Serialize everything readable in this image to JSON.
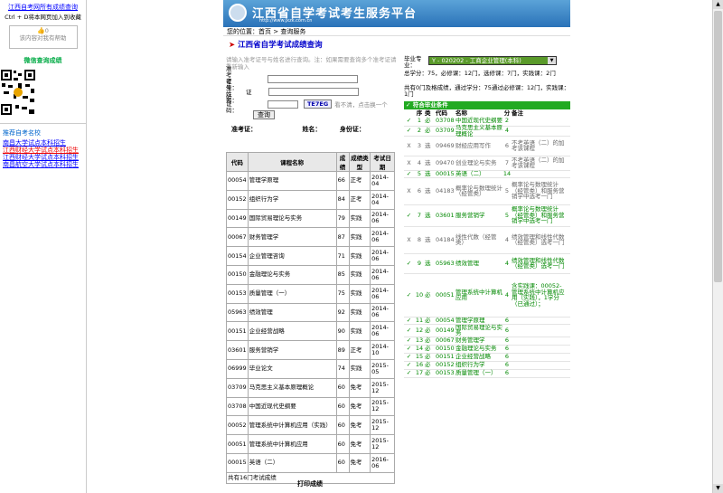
{
  "left": {
    "title": "江西自考网所有成绩查询",
    "hint": "Ctrl + D将本网页加入到收藏",
    "vote_count": "0",
    "vote_text": "该内容对我有帮助",
    "qr_title": "微信查询成绩",
    "recommend_title": "推荐自考名校",
    "links": [
      {
        "text": "南昌大学试点本科招生",
        "red": false
      },
      {
        "text": "江西财经大学试点本科招生",
        "red": true
      },
      {
        "text": "江西财经大学试点本科招生",
        "red": false
      },
      {
        "text": "南昌航空大学试点本科招生",
        "red": false
      }
    ]
  },
  "banner": {
    "title": "江西省自学考试考生服务平台",
    "url": "http://www.jxzk.com.cn"
  },
  "crumb": {
    "prefix": "您的位置：",
    "home": "首页",
    "sep": " > ",
    "page": "查询服务"
  },
  "page_title": "江西省自学考试成绩查询",
  "form": {
    "notice": "请输入准考证号与姓名进行查询。注：如果需要查询多个准考证请重新输入",
    "f1": "准考证号：",
    "f2": "考生姓名：",
    "f3": "验证码：",
    "mid_label": "证",
    "captcha": "TE7EG",
    "captcha_hint": "看不清，点击换一个",
    "submit": "查询"
  },
  "info": {
    "ticket_label": "准考证：",
    "name_label": "姓名：",
    "id_label": "身份证："
  },
  "grades": {
    "headers": [
      "代码",
      "课程名称",
      "成绩",
      "成绩类型",
      "考试日期"
    ],
    "rows": [
      [
        "00054",
        "管理学原理",
        "66",
        "正考",
        "2014-04"
      ],
      [
        "00152",
        "组织行为学",
        "84",
        "正考",
        "2014-04"
      ],
      [
        "00149",
        "国际贸易理论与实务",
        "79",
        "实践",
        "2014-06"
      ],
      [
        "00067",
        "财务管理学",
        "87",
        "实践",
        "2014-06"
      ],
      [
        "00154",
        "企业管理咨询",
        "71",
        "实践",
        "2014-06"
      ],
      [
        "00150",
        "金融理论与实务",
        "85",
        "实践",
        "2014-06"
      ],
      [
        "00153",
        "质量管理（一）",
        "75",
        "实践",
        "2014-06"
      ],
      [
        "05963",
        "绩效管理",
        "92",
        "实践",
        "2014-06"
      ],
      [
        "00151",
        "企业经营战略",
        "90",
        "实践",
        "2014-06"
      ],
      [
        "03601",
        "服务营销学",
        "89",
        "正考",
        "2014-10"
      ],
      [
        "06999",
        "毕业论文",
        "74",
        "实践",
        "2015-05"
      ],
      [
        "03709",
        "马克思主义基本原理概论",
        "60",
        "免考",
        "2015-12"
      ],
      [
        "03708",
        "中国近现代史纲要",
        "60",
        "免考",
        "2015-12"
      ],
      [
        "00052",
        "管理系统中计算机应用（实践）",
        "60",
        "免考",
        "2015-12"
      ],
      [
        "00051",
        "管理系统中计算机应用",
        "60",
        "免考",
        "2015-12"
      ],
      [
        "00015",
        "英语（二）",
        "60",
        "免考",
        "2016-06"
      ]
    ],
    "footer": "共有16门考试成绩",
    "print": "打印成绩"
  },
  "plan": {
    "major_label": "毕业专业：",
    "major_value": "Y - 020202 - 工商企业管理(本科)",
    "summary": "总学分：75，必修课：12门，选修课：7门，实践课：2门",
    "status": "共有0门及格成绩，通过学分：75通过必修课：12门，实践课：1门",
    "group": "✓ 符合毕业条件",
    "cols": [
      "序",
      "类",
      "代码",
      "名称",
      "分",
      "备注"
    ],
    "rows": [
      {
        "ok": "✓",
        "i": "1",
        "t": "必",
        "code": "03708",
        "name": "中国近现代史纲要",
        "cr": "2",
        "note": "",
        "pass": true
      },
      {
        "ok": "✓",
        "i": "2",
        "t": "必",
        "code": "03709",
        "name": "马克思主义基本原理概论",
        "cr": "4",
        "note": "",
        "pass": true
      },
      {
        "ok": "X",
        "i": "3",
        "t": "选",
        "code": "09469",
        "name": "财经应用写作",
        "cr": "6",
        "note": "不考英语（二）的加考该课程",
        "pass": false
      },
      {
        "ok": "X",
        "i": "4",
        "t": "选",
        "code": "09470",
        "name": "创业理论与实务",
        "cr": "7",
        "note": "不考英语（二）的加考该课程",
        "pass": false
      },
      {
        "ok": "✓",
        "i": "5",
        "t": "选",
        "code": "00015",
        "name": "英语（二）",
        "cr": "14",
        "note": "",
        "pass": true
      },
      {
        "ok": "X",
        "i": "6",
        "t": "选",
        "code": "04183",
        "name": "概率论与数理统计（经管类）",
        "cr": "5",
        "note": "概率论与数理统计（经管类）和服务营销学中选考一门",
        "pass": false
      },
      {
        "ok": "✓",
        "i": "7",
        "t": "选",
        "code": "03601",
        "name": "服务营销学",
        "cr": "5",
        "note": "概率论与数理统计（经管类）和服务营销学中选考一门",
        "pass": true
      },
      {
        "ok": "X",
        "i": "8",
        "t": "选",
        "code": "04184",
        "name": "线性代数（经管类）",
        "cr": "4",
        "note": "绩效管理和线性代数（经管类）选考一门",
        "pass": false
      },
      {
        "ok": "✓",
        "i": "9",
        "t": "选",
        "code": "05963",
        "name": "绩效管理",
        "cr": "4",
        "note": "绩效管理和线性代数（经管类）选考一门",
        "pass": true
      },
      {
        "ok": "✓",
        "i": "10",
        "t": "必",
        "code": "00051",
        "name": "管理系统中计算机应用",
        "cr": "4",
        "note": "含实践课：00052-管理系统中计算机应用（实践），1学分（已通过）；",
        "pass": true
      },
      {
        "ok": "✓",
        "i": "11",
        "t": "必",
        "code": "00054",
        "name": "管理学原理",
        "cr": "6",
        "note": "",
        "pass": true
      },
      {
        "ok": "✓",
        "i": "12",
        "t": "必",
        "code": "00149",
        "name": "国际贸易理论与实务",
        "cr": "6",
        "note": "",
        "pass": true
      },
      {
        "ok": "✓",
        "i": "13",
        "t": "必",
        "code": "00067",
        "name": "财务管理学",
        "cr": "6",
        "note": "",
        "pass": true
      },
      {
        "ok": "✓",
        "i": "14",
        "t": "必",
        "code": "00150",
        "name": "金融理论与实务",
        "cr": "6",
        "note": "",
        "pass": true
      },
      {
        "ok": "✓",
        "i": "15",
        "t": "必",
        "code": "00151",
        "name": "企业经营战略",
        "cr": "6",
        "note": "",
        "pass": true
      },
      {
        "ok": "✓",
        "i": "16",
        "t": "必",
        "code": "00152",
        "name": "组织行为学",
        "cr": "6",
        "note": "",
        "pass": true
      },
      {
        "ok": "✓",
        "i": "17",
        "t": "必",
        "code": "00153",
        "name": "质量管理（一）",
        "cr": "6",
        "note": "",
        "pass": true
      }
    ]
  }
}
